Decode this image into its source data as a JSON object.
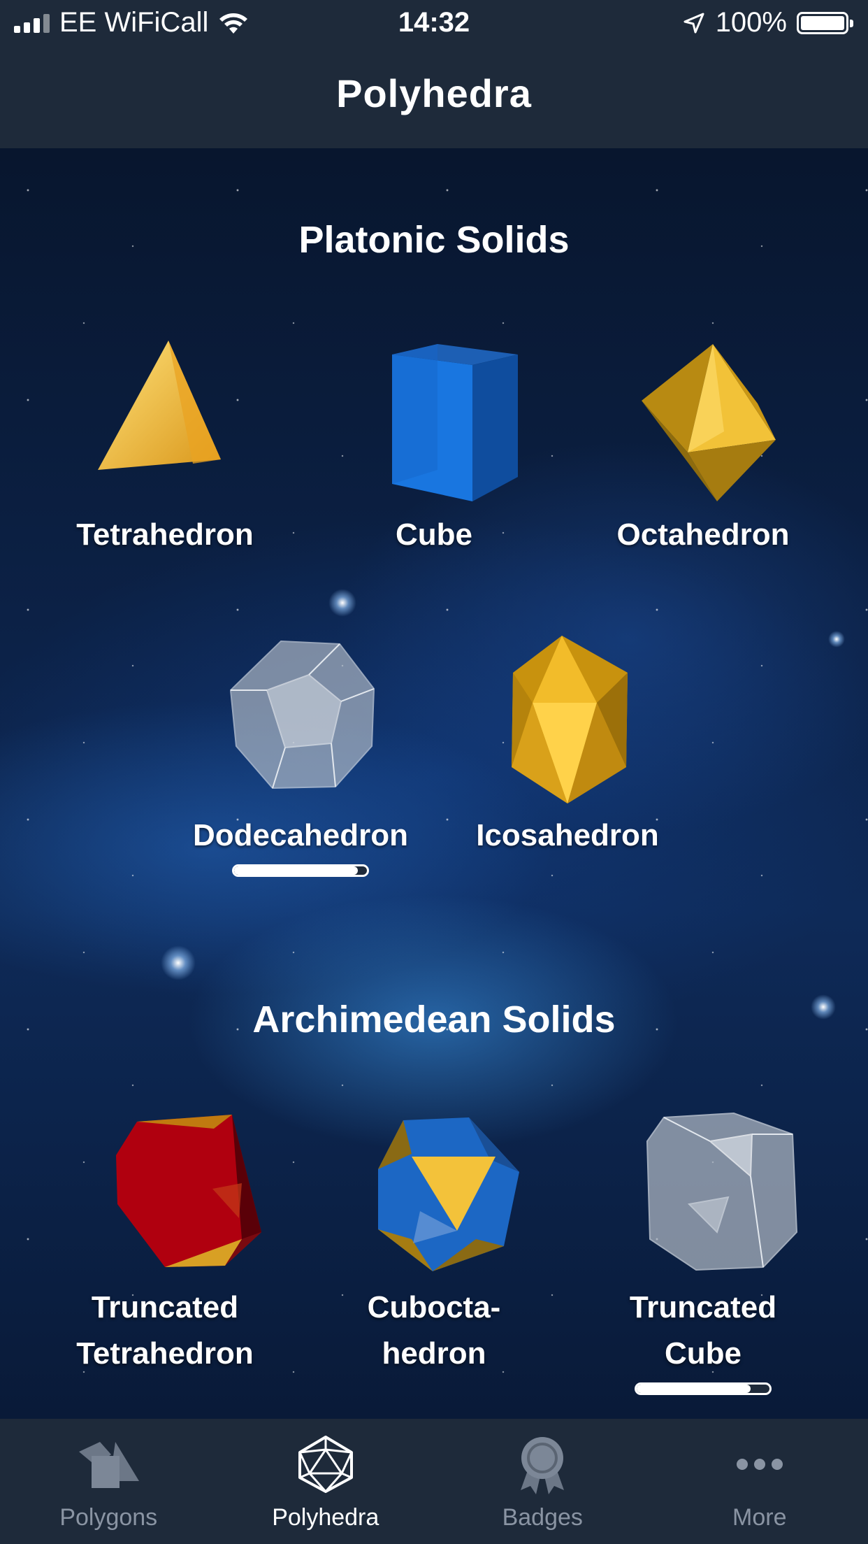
{
  "status_bar": {
    "carrier": "EE WiFiCall",
    "time": "14:32",
    "battery": "100%"
  },
  "nav": {
    "title": "Polyhedra"
  },
  "sections": [
    {
      "title": "Platonic Solids",
      "items": [
        {
          "label": "Tetrahedron"
        },
        {
          "label": "Cube"
        },
        {
          "label": "Octahedron"
        },
        {
          "label": "Dodecahedron",
          "progress": 0.93
        },
        {
          "label": "Icosahedron"
        }
      ]
    },
    {
      "title": "Archimedean Solids",
      "items": [
        {
          "label_line1": "Truncated",
          "label_line2": "Tetrahedron"
        },
        {
          "label_line1": "Cubocta-",
          "label_line2": "hedron"
        },
        {
          "label_line1": "Truncated",
          "label_line2": "Cube",
          "progress": 0.86
        }
      ]
    }
  ],
  "tabs": [
    {
      "label": "Polygons",
      "icon": "polygons-icon",
      "active": false
    },
    {
      "label": "Polyhedra",
      "icon": "polyhedron-icon",
      "active": true
    },
    {
      "label": "Badges",
      "icon": "badge-icon",
      "active": false
    },
    {
      "label": "More",
      "icon": "more-dots-icon",
      "active": false
    }
  ],
  "colors": {
    "bar_background": "#1e2a3a",
    "tab_inactive": "#8a94a3",
    "tab_active": "#ffffff",
    "gold": "#e8b020",
    "blue": "#1565c8",
    "red": "#b00010",
    "glass": "#a9b3bf"
  }
}
